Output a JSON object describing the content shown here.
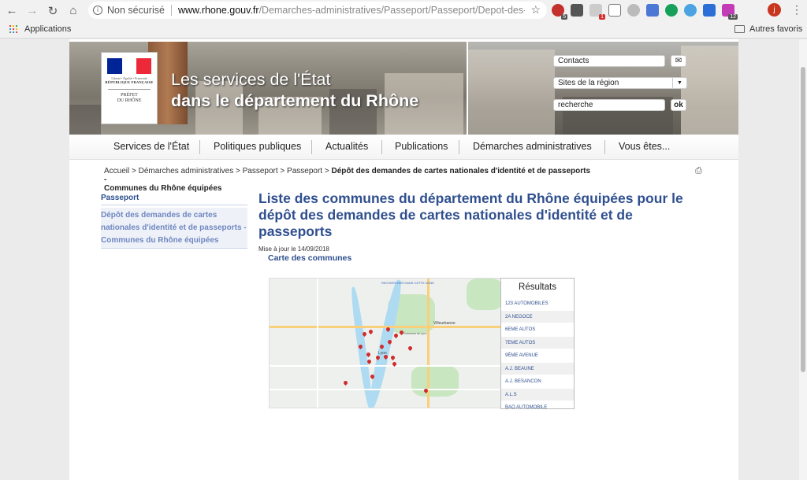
{
  "browser": {
    "security_text": "Non sécurisé",
    "url_domain": "www.rhone.gouv.fr",
    "url_path": "/Demarches-administratives/Passeport/Passeport/Depot-des-...",
    "bookmark_apps": "Applications",
    "bookmark_folder": "Autres favoris",
    "profile_initial": "j",
    "ext_badges": [
      "5",
      "1",
      "12"
    ]
  },
  "banner": {
    "flag_motto": "Liberté • Égalité • Fraternité",
    "flag_rf": "RÉPUBLIQUE FRANÇAISE",
    "prefet_line1": "PRÉFET",
    "prefet_line2": "DU RHÔNE",
    "title_line1": "Les services de l'État",
    "title_line2": "dans le département du Rhône",
    "contacts_label": "Contacts",
    "sites_label": "Sites de la région",
    "search_placeholder": "recherche",
    "ok_label": "ok"
  },
  "menu": {
    "items": [
      "Services de l'État",
      "Politiques publiques",
      "Actualités",
      "Publications",
      "Démarches administratives",
      "Vous êtes..."
    ]
  },
  "breadcrumb": {
    "trail": "Accueil > Démarches administratives > Passeport > Passeport > ",
    "current_line1": "Dépôt des demandes de cartes nationales d'identité et de passeports -",
    "current_line2": "Communes du Rhône équipées"
  },
  "sidebar": {
    "title": "Passeport",
    "item_line1": "Dépôt des demandes de cartes",
    "item_line2": "nationales d'identité et de passeports -",
    "item_line3": "Communes du Rhône équipées"
  },
  "main": {
    "title_line1": "Liste des communes du département du Rhône équipées pour le",
    "title_line2": "dépôt des demandes de cartes nationales d'identité et de",
    "title_line3": "passeports",
    "updated": "Mise à jour le 14/09/2018",
    "map_heading": "Carte des communes"
  },
  "map": {
    "search_zone_label": "RECHERCHER DANS CETTE ZONE",
    "label_villeurbanne": "Villeurbanne",
    "label_lyon": "Lyon",
    "label_commune": "Commune de Lyon"
  },
  "results": {
    "title": "Résultats",
    "rows": [
      "123 AUTOMOBILES",
      "2A NEGOCE",
      "6EME AUTOS",
      "7EME AUTOS",
      "9ÈME AVENUE",
      "A.J. BEAUNE",
      "A.J. BESANCON",
      "A.L.S",
      "BAO AUTOMOBILE"
    ]
  },
  "colors": {
    "accent_blue": "#2f4f8f",
    "link_blue": "#6f86c0",
    "flag_blue": "#002395",
    "flag_red": "#ed2939"
  }
}
